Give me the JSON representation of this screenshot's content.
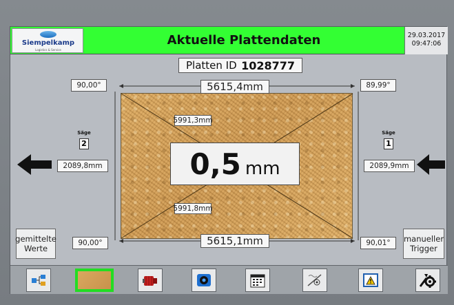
{
  "header": {
    "logo_name": "Siempelkamp",
    "logo_sub": "Logistics & Service",
    "title": "Aktuelle Plattendaten",
    "date": "29.03.2017",
    "time": "09:47:06"
  },
  "panel_id": {
    "label": "Platten ID",
    "value": "1028777"
  },
  "measurements": {
    "top_length": "5615,4mm",
    "bottom_length": "5615,1mm",
    "diagonal_top": "5991,3mm",
    "diagonal_bottom": "5991,8mm",
    "angle_top_left": "90,00°",
    "angle_top_right": "89,99°",
    "angle_bottom_left": "90,00°",
    "angle_bottom_right": "90,01°",
    "width_left": "2089,8mm",
    "width_right": "2089,9mm",
    "thickness_value": "0,5",
    "thickness_unit": "mm"
  },
  "saws": {
    "left": {
      "label": "Säge",
      "number": "2"
    },
    "right": {
      "label": "Säge",
      "number": "1"
    }
  },
  "buttons": {
    "averaged_values": "gemittelte\nWerte",
    "manual_trigger": "manueller\nTrigger"
  },
  "toolbar": {
    "items": [
      {
        "icon": "flow-icon"
      },
      {
        "icon": "board-icon",
        "active": true
      },
      {
        "icon": "motor-icon"
      },
      {
        "icon": "camera-icon"
      },
      {
        "icon": "calendar-icon"
      },
      {
        "icon": "diagnostics-icon"
      },
      {
        "icon": "warning-icon"
      },
      {
        "icon": "settings-icon"
      }
    ]
  },
  "colors": {
    "header_green": "#33ff33",
    "active_green": "#22dd22"
  }
}
